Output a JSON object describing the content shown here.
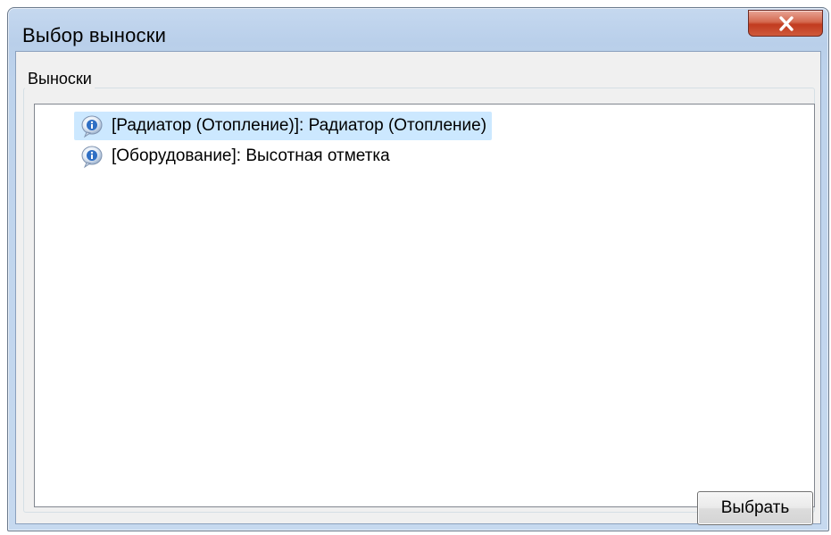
{
  "window": {
    "title": "Выбор выноски",
    "close_icon": "close-icon"
  },
  "group": {
    "label": "Выноски"
  },
  "list": {
    "items": [
      {
        "label": "[Радиатор (Отопление)]: Радиатор (Отопление)",
        "icon": "info-icon",
        "selected": true
      },
      {
        "label": "[Оборудование]: Высотная отметка",
        "icon": "info-icon",
        "selected": false
      }
    ]
  },
  "buttons": {
    "select_label": "Выбрать"
  },
  "colors": {
    "selection": "#cce8ff",
    "close_button": "#c23b1f",
    "title_bar": "#b9cfea"
  }
}
